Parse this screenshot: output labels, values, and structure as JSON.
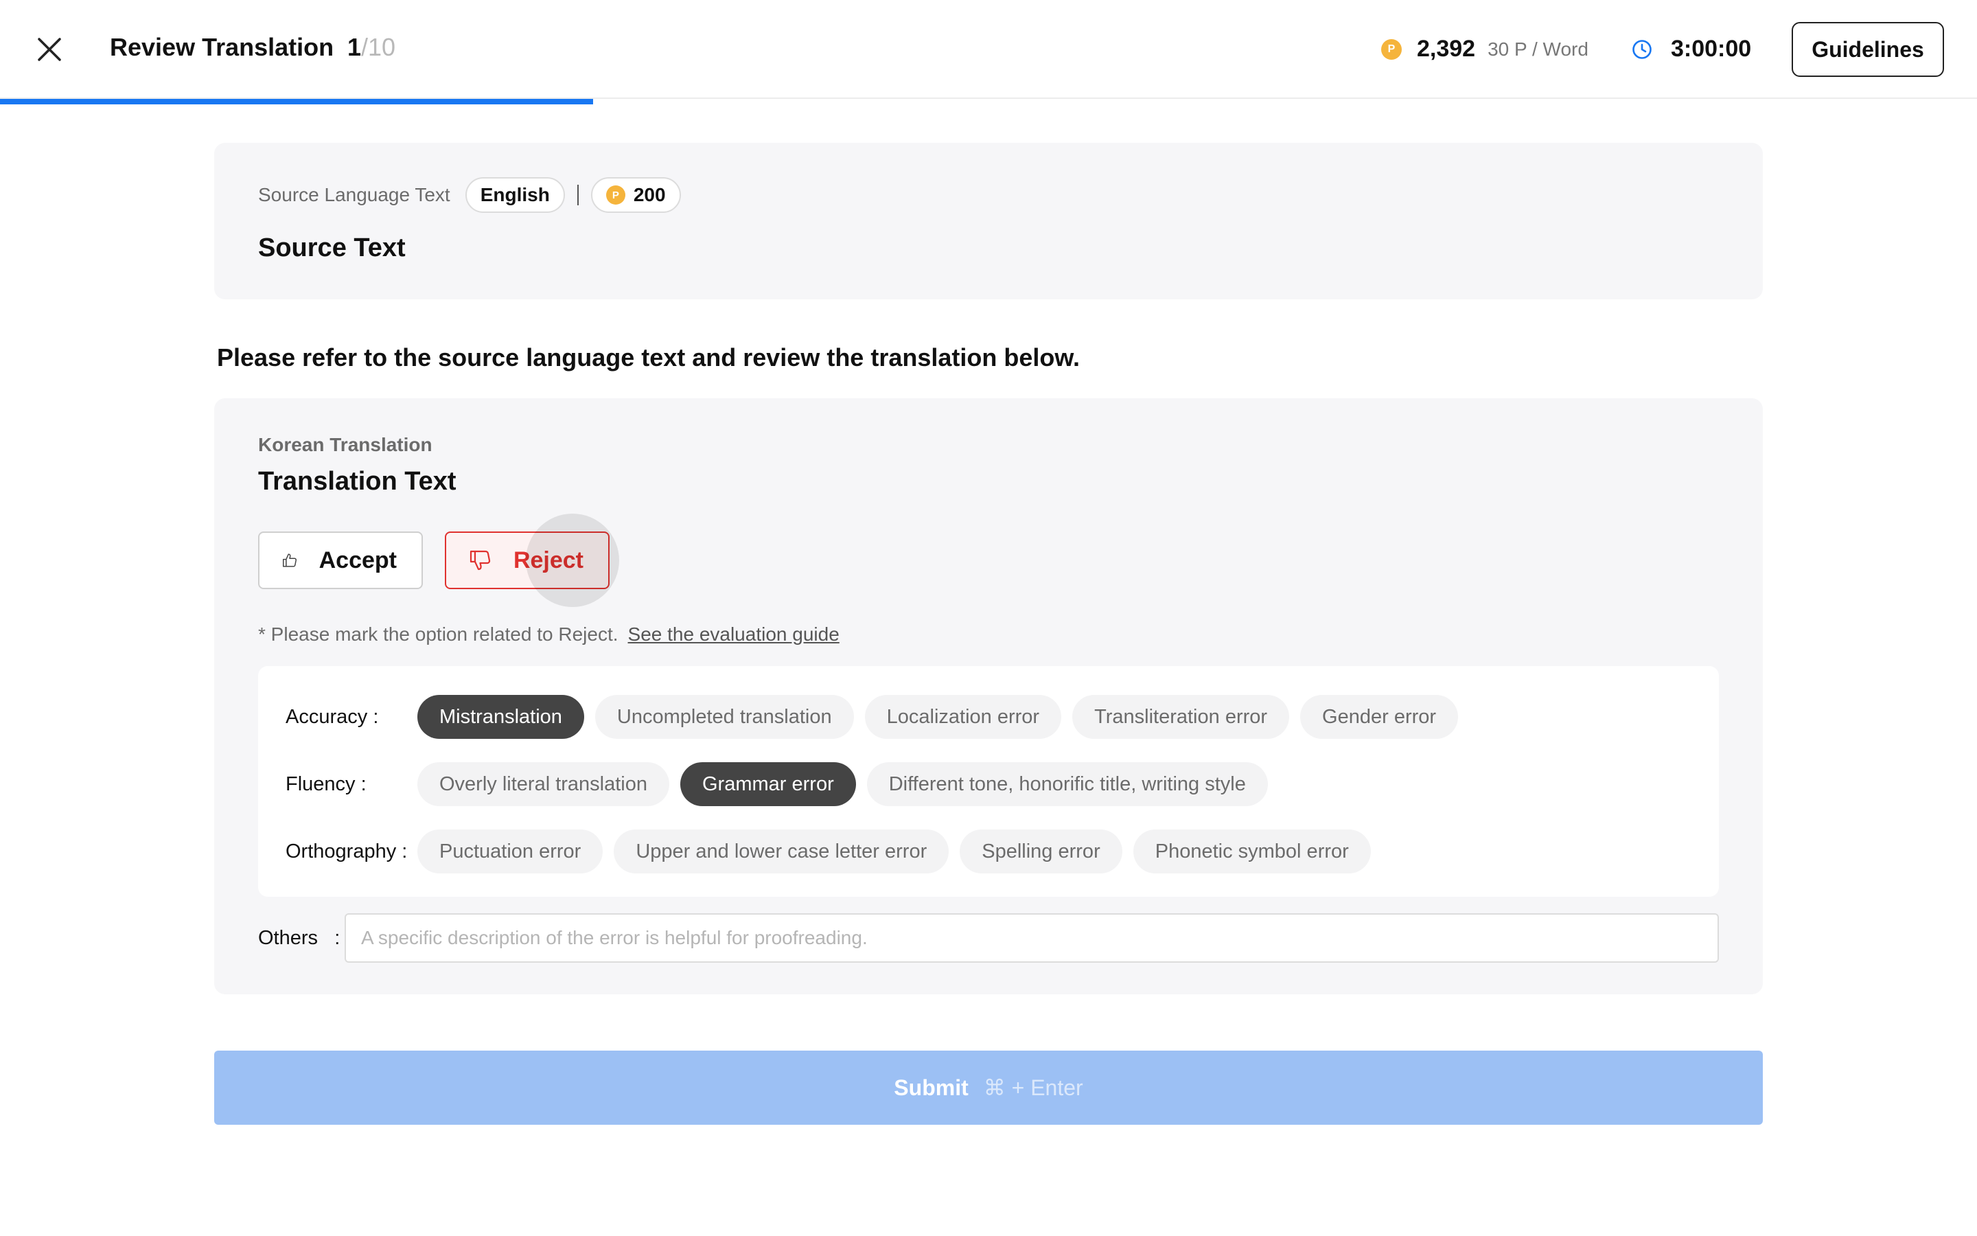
{
  "header": {
    "title": "Review Translation",
    "current": "1",
    "total": "/10",
    "progress": 0.3,
    "points_value": "2,392",
    "points_rate": "30 P / Word",
    "coin_symbol": "P",
    "timer": "3:00:00",
    "guidelines_label": "Guidelines"
  },
  "source": {
    "label": "Source Language Text",
    "language": "English",
    "credits": "200",
    "text": "Source Text"
  },
  "instruction": "Please refer to the source language text and review the translation below.",
  "translation": {
    "label": "Korean Translation",
    "text": "Translation Text",
    "accept_label": "Accept",
    "reject_label": "Reject",
    "hint": "* Please mark the option related to Reject.",
    "guide_link": "See the evaluation guide"
  },
  "categories": [
    {
      "label": "Accuracy :",
      "options": [
        {
          "label": "Mistranslation",
          "selected": true
        },
        {
          "label": "Uncompleted translation",
          "selected": false
        },
        {
          "label": "Localization error",
          "selected": false
        },
        {
          "label": "Transliteration error",
          "selected": false
        },
        {
          "label": "Gender error",
          "selected": false
        }
      ]
    },
    {
      "label": "Fluency :",
      "options": [
        {
          "label": "Overly literal translation",
          "selected": false
        },
        {
          "label": "Grammar error",
          "selected": true
        },
        {
          "label": "Different tone, honorific title, writing style",
          "selected": false
        }
      ]
    },
    {
      "label": "Orthography :",
      "options": [
        {
          "label": "Puctuation error",
          "selected": false
        },
        {
          "label": "Upper and lower case letter error",
          "selected": false
        },
        {
          "label": "Spelling error",
          "selected": false
        },
        {
          "label": "Phonetic symbol error",
          "selected": false
        }
      ]
    }
  ],
  "others": {
    "label": "Others",
    "colon": ":",
    "placeholder": "A specific description of the error is helpful for proofreading.",
    "value": ""
  },
  "submit": {
    "label": "Submit",
    "shortcut": "⌘ + Enter"
  },
  "colors": {
    "accent": "#1877f2",
    "reject": "#e0322f",
    "selected_chip": "#444444",
    "coin": "#f5b43c",
    "submit_disabled": "#9cc0f4"
  },
  "icons": {
    "close": "close-icon",
    "coin": "coin-icon",
    "clock": "clock-icon",
    "thumbs_up": "thumbs-up-icon",
    "thumbs_down": "thumbs-down-icon"
  }
}
